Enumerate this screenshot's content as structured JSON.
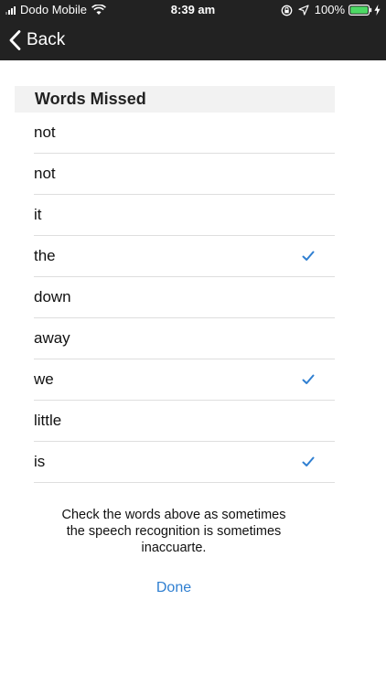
{
  "status_bar": {
    "carrier": "Dodo Mobile",
    "time": "8:39 am",
    "battery": "100%",
    "icons": [
      "signal-icon",
      "wifi-icon",
      "lock-rotation-icon",
      "location-icon",
      "battery-icon",
      "charging-icon"
    ]
  },
  "nav": {
    "back_label": "Back"
  },
  "section": {
    "title": "Words Missed"
  },
  "words": [
    {
      "word": "not",
      "checked": false
    },
    {
      "word": "not",
      "checked": false
    },
    {
      "word": "it",
      "checked": false
    },
    {
      "word": "the",
      "checked": true
    },
    {
      "word": "down",
      "checked": false
    },
    {
      "word": "away",
      "checked": false
    },
    {
      "word": "we",
      "checked": true
    },
    {
      "word": "little",
      "checked": false
    },
    {
      "word": "is",
      "checked": true
    }
  ],
  "help_text": "Check the words above as sometimes the speech recognition is sometimes inaccuarte.",
  "done_label": "Done",
  "colors": {
    "accent": "#2f7fd1",
    "nav_bg": "#222222",
    "header_bg": "#f2f2f2",
    "battery": "#4cd964"
  }
}
